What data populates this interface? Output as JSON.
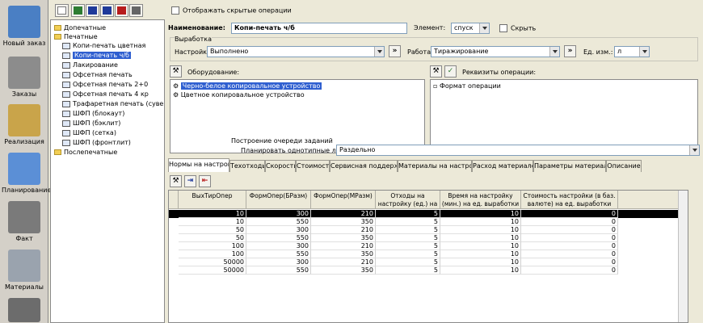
{
  "sidebar": {
    "items": [
      {
        "label": "Новый заказ",
        "color": "#4a7fc4"
      },
      {
        "label": "Заказы",
        "color": "#8c8c8c"
      },
      {
        "label": "Реализация",
        "color": "#c9a44a"
      },
      {
        "label": "Планирование",
        "color": "#5b8fd6"
      },
      {
        "label": "Факт",
        "color": "#7a7a7a"
      },
      {
        "label": "Материалы",
        "color": "#9aa3ae"
      }
    ]
  },
  "toolbar": {
    "buttons": [
      "new-icon",
      "save-icon",
      "import-icon",
      "export-icon",
      "delete-icon",
      "print-icon"
    ],
    "show_hidden_label": "Отображать скрытые операции"
  },
  "tree": {
    "items": [
      {
        "label": "Допечатные",
        "type": "folder",
        "indent": 0
      },
      {
        "label": "Печатные",
        "type": "folder-open",
        "indent": 0
      },
      {
        "label": "Копи-печать цветная",
        "type": "node",
        "indent": 1
      },
      {
        "label": "Копи-печать ч/б",
        "type": "node",
        "indent": 1,
        "selected": true
      },
      {
        "label": "Лакирование",
        "type": "node",
        "indent": 1
      },
      {
        "label": "Офсетная печать",
        "type": "node",
        "indent": 1
      },
      {
        "label": "Офсетная печать 2+0",
        "type": "node",
        "indent": 1
      },
      {
        "label": "Офсетная печать 4 кр",
        "type": "node",
        "indent": 1
      },
      {
        "label": "Трафаретная печать (сувенир",
        "type": "node",
        "indent": 1
      },
      {
        "label": "ШФП (блокаут)",
        "type": "node",
        "indent": 1
      },
      {
        "label": "ШФП (бэклит)",
        "type": "node",
        "indent": 1
      },
      {
        "label": "ШФП (сетка)",
        "type": "node",
        "indent": 1
      },
      {
        "label": "ШФП (фронтлит)",
        "type": "node",
        "indent": 1
      },
      {
        "label": "Послепечатные",
        "type": "folder",
        "indent": 0
      }
    ]
  },
  "form": {
    "name_label": "Наименование:",
    "name_value": "Копи-печать ч/б",
    "element_label": "Элемент:",
    "element_value": "спуск",
    "hide_label": "Скрыть",
    "output_group": "Выработка",
    "setup_label": "Настройка:",
    "setup_value": "Выполнено",
    "work_label": "Работа:",
    "work_value": "Тиражирование",
    "unit_label": "Ед. изм.:",
    "unit_value": "л",
    "arrow_btn": "»",
    "equipment_label": "Оборудование:",
    "equipment_items": [
      "Черно-белое копировальное устройство",
      "Цветное копировальное устройство"
    ],
    "requisites_label": "Реквизиты операции:",
    "requisites_items": [
      "Формат операции"
    ],
    "queue_group": "Построение очереди заданий",
    "plan_label": "Планировать однотипные листы:",
    "plan_value": "Раздельно"
  },
  "tabs": [
    "Нормы на настройку",
    "Техотходы",
    "Скорость",
    "Стоимость",
    "Сервисная поддержка",
    "Материалы на настройку",
    "Расход материалов",
    "Параметры материалов",
    "Описание"
  ],
  "table": {
    "headers": [
      "ВыхТирОпер",
      "ФормОпер(БРазм)",
      "ФормОпер(МРазм)",
      "Отходы на настройку (ед.) на ед. выработки",
      "Время на настройку (мин.) на ед. выработки",
      "Стоимость настройки (в баз. валюте) на ед. выработки"
    ],
    "rows": [
      [
        "10",
        "300",
        "210",
        "5",
        "10",
        "0"
      ],
      [
        "10",
        "550",
        "350",
        "5",
        "10",
        "0"
      ],
      [
        "50",
        "300",
        "210",
        "5",
        "10",
        "0"
      ],
      [
        "50",
        "550",
        "350",
        "5",
        "10",
        "0"
      ],
      [
        "100",
        "300",
        "210",
        "5",
        "10",
        "0"
      ],
      [
        "100",
        "550",
        "350",
        "5",
        "10",
        "0"
      ],
      [
        "50000",
        "300",
        "210",
        "5",
        "10",
        "0"
      ],
      [
        "50000",
        "550",
        "350",
        "5",
        "10",
        "0"
      ]
    ]
  }
}
